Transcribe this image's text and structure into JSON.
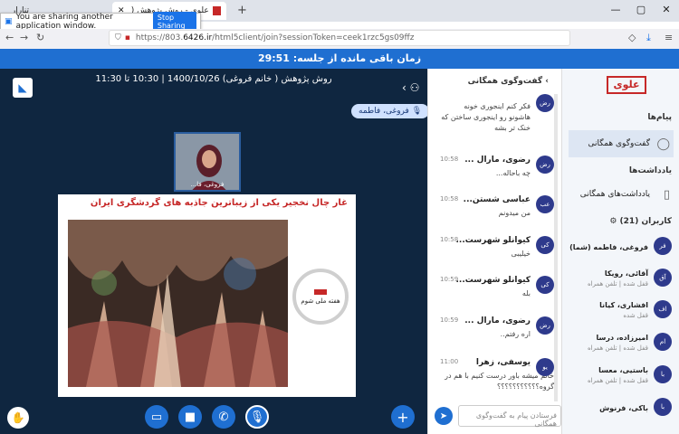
{
  "browser": {
    "tab_title": "علوی - روش پژوهش ( خانم فروغ...",
    "tab2_title": "تنارار",
    "share_notice": "You are sharing another application window.",
    "stop_sharing_label": "Stop Sharing",
    "url_prefix": "https://803.",
    "url_domain": "6426.ir",
    "url_path": "/html5client/join?sessionToken=ceek1rzc5gs09ffz"
  },
  "timer": {
    "label": "زمان باقی مانده از جلسه: 29:51"
  },
  "meeting": {
    "title": "روش پژوهش ( خانم فروغی) 1400/10/26 | 10:30 تا 11:30",
    "presenter_badge": "فروغی، فاطمه",
    "webcam_label": "فروغی، فا...",
    "slide_title": "غار چال نخجیر یکی از زیباترین جاذبه های گردشگری ایران",
    "seal_text": "هفته ملی شوم"
  },
  "chat": {
    "header": "گفت‌وگوی همگانی",
    "input_placeholder": "فرستادن پیام به گفت‌وگوی همگانی",
    "messages": [
      {
        "avatar": "رض",
        "name": "",
        "time": "",
        "text": "فکر کنم اینجوری خونه هاشونو رو اینجوری ساختن که خنک تر بشه"
      },
      {
        "avatar": "رض",
        "name": "رضوی، مارال ...",
        "time": "10:58",
        "text": "چه باحاله..."
      },
      {
        "avatar": "عب",
        "name": "عباسی شستن...",
        "time": "10:58",
        "text": "من میدونم"
      },
      {
        "avatar": "کی",
        "name": "کیوانلو شهرست...",
        "time": "10:58",
        "text": "خیلیبی"
      },
      {
        "avatar": "کی",
        "name": "کیوانلو شهرست...",
        "time": "10:59",
        "text": "بله"
      },
      {
        "avatar": "رض",
        "name": "رضوی، مارال ...",
        "time": "10:59",
        "text": "اره رفتم.."
      },
      {
        "avatar": "یو",
        "name": "یوسفی، زهرا",
        "time": "11:00",
        "text": "خانم میشه باور درست کنیم با هم در گروه؟؟؟؟؟؟؟؟؟؟؟"
      }
    ]
  },
  "nav": {
    "brand": "علوی",
    "messages_section": "پیام‌ها",
    "public_chat": "گفت‌وگوی همگانی",
    "notes_section": "یادداشت‌ها",
    "shared_notes": "یادداشت‌های همگانی",
    "users_section": "کاربران (21)",
    "users": [
      {
        "avatar": "فر",
        "name": "فروغی، فاطمه (شما)",
        "status": ""
      },
      {
        "avatar": "آق",
        "name": "آقائی، رویکا",
        "status": "قفل شده | تلفن همراه"
      },
      {
        "avatar": "اف",
        "name": "افشاری، کیانا",
        "status": "قفل شده"
      },
      {
        "avatar": "ام",
        "name": "امیرزاده، درسا",
        "status": "قفل شده | تلفن همراه"
      },
      {
        "avatar": "با",
        "name": "باستیی، معسا",
        "status": "قفل شده | تلفن همراه"
      },
      {
        "avatar": "با",
        "name": "باکی، فرنوش",
        "status": ""
      }
    ]
  }
}
